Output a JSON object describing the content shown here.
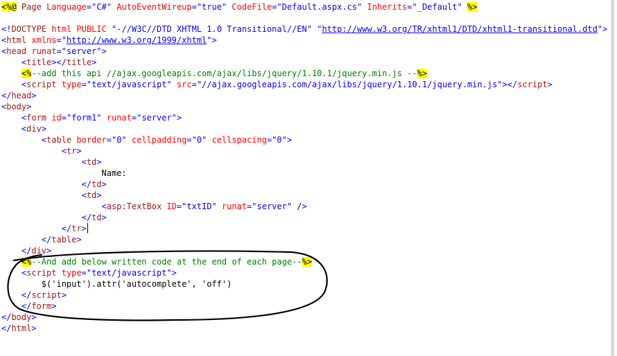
{
  "editor": {
    "lines": [
      [
        [
          "hl",
          "<%@"
        ],
        [
          "blue",
          " "
        ],
        [
          "brown",
          "Page"
        ],
        [
          "blue",
          " "
        ],
        [
          "red",
          "Language"
        ],
        [
          "blue",
          "=\"C#\" "
        ],
        [
          "red",
          "AutoEventWireup"
        ],
        [
          "blue",
          "=\"true\" "
        ],
        [
          "red",
          "CodeFile"
        ],
        [
          "blue",
          "=\"Default.aspx.cs\" "
        ],
        [
          "red",
          "Inherits"
        ],
        [
          "blue",
          "=\"_Default\" "
        ],
        [
          "hl",
          "%>"
        ]
      ],
      [],
      [
        [
          "blue",
          "<!"
        ],
        [
          "brown",
          "DOCTYPE"
        ],
        [
          "blue",
          " "
        ],
        [
          "red",
          "html"
        ],
        [
          "blue",
          " "
        ],
        [
          "red",
          "PUBLIC"
        ],
        [
          "blue",
          " \"-//W3C//DTD XHTML 1.0 Transitional//EN\" \""
        ],
        [
          "link",
          "http://www.w3.org/TR/xhtml1/DTD/xhtml1-transitional.dtd"
        ],
        [
          "blue",
          "\">"
        ]
      ],
      [
        [
          "blue",
          "<"
        ],
        [
          "brown",
          "html"
        ],
        [
          "blue",
          " "
        ],
        [
          "red",
          "xmlns"
        ],
        [
          "blue",
          "=\""
        ],
        [
          "link",
          "http://www.w3.org/1999/xhtml"
        ],
        [
          "blue",
          "\">"
        ]
      ],
      [
        [
          "blue",
          "<"
        ],
        [
          "brown",
          "head"
        ],
        [
          "blue",
          " "
        ],
        [
          "red",
          "runat"
        ],
        [
          "blue",
          "=\"server\">"
        ]
      ],
      [
        [
          "blue",
          "    <"
        ],
        [
          "brown",
          "title"
        ],
        [
          "blue",
          "></"
        ],
        [
          "brown",
          "title"
        ],
        [
          "blue",
          ">"
        ]
      ],
      [
        [
          "black",
          "    "
        ],
        [
          "hl",
          "<%"
        ],
        [
          "green",
          "--add this api //ajax.googleapis.com/ajax/libs/jquery/1.10.1/jquery.min.js --"
        ],
        [
          "hl",
          "%>"
        ]
      ],
      [
        [
          "blue",
          "    <"
        ],
        [
          "brown",
          "script"
        ],
        [
          "blue",
          " "
        ],
        [
          "red",
          "type"
        ],
        [
          "blue",
          "=\"text/javascript\" "
        ],
        [
          "red",
          "src"
        ],
        [
          "blue",
          "=\"//ajax.googleapis.com/ajax/libs/jquery/1.10.1/jquery.min.js\"></"
        ],
        [
          "brown",
          "script"
        ],
        [
          "blue",
          ">"
        ]
      ],
      [
        [
          "blue",
          "</"
        ],
        [
          "brown",
          "head"
        ],
        [
          "blue",
          ">"
        ]
      ],
      [
        [
          "blue",
          "<"
        ],
        [
          "brown",
          "body"
        ],
        [
          "blue",
          ">"
        ]
      ],
      [
        [
          "blue",
          "    <"
        ],
        [
          "brown",
          "form"
        ],
        [
          "blue",
          " "
        ],
        [
          "red",
          "id"
        ],
        [
          "blue",
          "=\"form1\" "
        ],
        [
          "red",
          "runat"
        ],
        [
          "blue",
          "=\"server\">"
        ]
      ],
      [
        [
          "blue",
          "    <"
        ],
        [
          "brown",
          "div"
        ],
        [
          "blue",
          ">"
        ]
      ],
      [
        [
          "blue",
          "        <"
        ],
        [
          "brown",
          "table"
        ],
        [
          "blue",
          " "
        ],
        [
          "red",
          "border"
        ],
        [
          "blue",
          "=\"0\" "
        ],
        [
          "red",
          "cellpadding"
        ],
        [
          "blue",
          "=\"0\" "
        ],
        [
          "red",
          "cellspacing"
        ],
        [
          "blue",
          "=\"0\">"
        ]
      ],
      [
        [
          "blue",
          "            <"
        ],
        [
          "brown",
          "tr"
        ],
        [
          "blue",
          ">"
        ]
      ],
      [
        [
          "blue",
          "                <"
        ],
        [
          "brown",
          "td"
        ],
        [
          "blue",
          ">"
        ]
      ],
      [
        [
          "black",
          "                    Name:"
        ]
      ],
      [
        [
          "blue",
          "                </"
        ],
        [
          "brown",
          "td"
        ],
        [
          "blue",
          ">"
        ]
      ],
      [
        [
          "blue",
          "                <"
        ],
        [
          "brown",
          "td"
        ],
        [
          "blue",
          ">"
        ]
      ],
      [
        [
          "blue",
          "                    <"
        ],
        [
          "brown",
          "asp:TextBox"
        ],
        [
          "blue",
          " "
        ],
        [
          "red",
          "ID"
        ],
        [
          "blue",
          "=\"txtID\" "
        ],
        [
          "red",
          "runat"
        ],
        [
          "blue",
          "=\"server\" />"
        ]
      ],
      [
        [
          "blue",
          "                </"
        ],
        [
          "brown",
          "td"
        ],
        [
          "blue",
          ">"
        ]
      ],
      [
        [
          "blue",
          "            </"
        ],
        [
          "brown",
          "tr"
        ],
        [
          "blue",
          ">"
        ]
      ],
      [
        [
          "blue",
          "        </"
        ],
        [
          "brown",
          "table"
        ],
        [
          "blue",
          ">"
        ]
      ],
      [
        [
          "blue",
          "    </"
        ],
        [
          "brown",
          "div"
        ],
        [
          "blue",
          ">"
        ]
      ],
      [
        [
          "black",
          "    "
        ],
        [
          "hl",
          "<%"
        ],
        [
          "green",
          "--And add below written code at the end of each page--"
        ],
        [
          "hl",
          "%>"
        ]
      ],
      [
        [
          "blue",
          "    <"
        ],
        [
          "brown",
          "script"
        ],
        [
          "blue",
          " "
        ],
        [
          "red",
          "type"
        ],
        [
          "blue",
          "=\"text/javascript\">"
        ]
      ],
      [
        [
          "black",
          "        $('input').attr('autocomplete', 'off')"
        ]
      ],
      [
        [
          "blue",
          "    </"
        ],
        [
          "brown",
          "script"
        ],
        [
          "blue",
          ">"
        ]
      ],
      [
        [
          "blue",
          "    </"
        ],
        [
          "brown",
          "form"
        ],
        [
          "blue",
          ">"
        ]
      ],
      [
        [
          "blue",
          "</"
        ],
        [
          "brown",
          "body"
        ],
        [
          "blue",
          ">"
        ]
      ],
      [
        [
          "blue",
          "</"
        ],
        [
          "brown",
          "html"
        ],
        [
          "blue",
          ">"
        ]
      ]
    ]
  }
}
